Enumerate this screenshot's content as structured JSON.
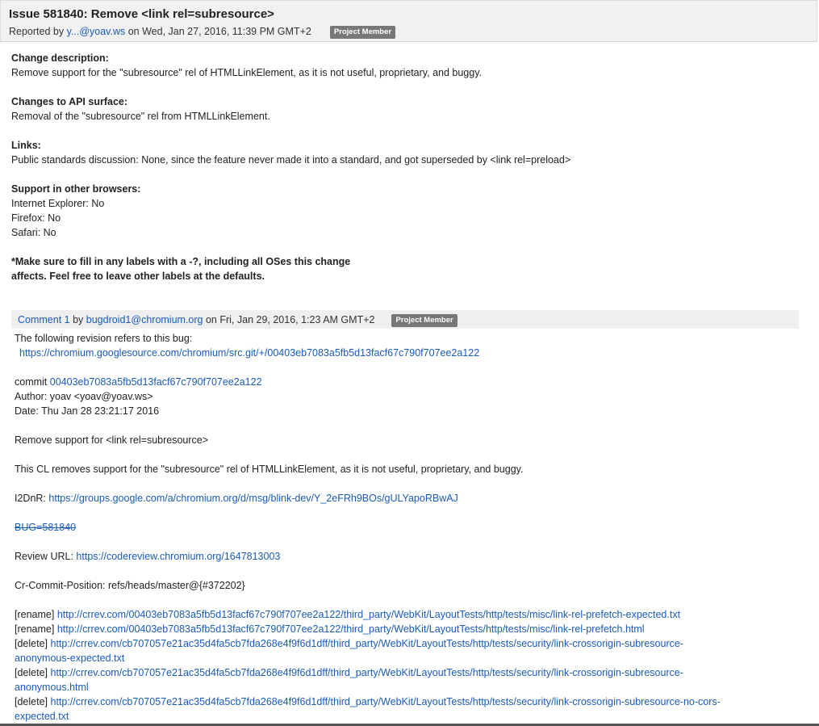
{
  "issue": {
    "title": "Issue 581840: Remove <link rel=subresource>",
    "reported_prefix": "Reported by",
    "reporter": "y...@yoav.ws",
    "reported_on": "on Wed, Jan 27, 2016, 11:39 PM GMT+2",
    "badge": "Project Member"
  },
  "description": {
    "change_desc_heading": "Change description:",
    "change_desc_text": "Remove support for the \"subresource\" rel of HTMLLinkElement, as it is not useful, proprietary, and buggy.",
    "api_heading": "Changes to API surface:",
    "api_text": "Removal of the \"subresource\" rel from HTMLLinkElement.",
    "links_heading": "Links:",
    "links_text": "Public standards discussion: None, since the feature never made it into a standard, and got superseded by <link rel=preload>",
    "browsers_heading": "Support in other browsers:",
    "browsers": [
      "Internet Explorer: No",
      "Firefox: No",
      "Safari: No"
    ],
    "note_line1": "*Make sure to fill in any labels with a -?, including all OSes this change",
    "note_line2": "affects. Feel free to leave other labels at the defaults."
  },
  "comment": {
    "label": "Comment 1",
    "by": "by",
    "author": "bugdroid1@chromium.org",
    "date": "on Fri, Jan 29, 2016, 1:23 AM GMT+2",
    "badge": "Project Member",
    "intro": "The following revision refers to this bug:",
    "revision_url": "https://chromium.googlesource.com/chromium/src.git/+/00403eb7083a5fb5d13facf67c790f707ee2a122",
    "commit_label": "commit",
    "commit_hash": "00403eb7083a5fb5d13facf67c790f707ee2a122",
    "author_line": "Author: yoav <yoav@yoav.ws>",
    "date_line": "Date: Thu Jan 28 23:21:17 2016",
    "summary": "Remove support for <link rel=subresource>",
    "cl_text": "This CL removes support for the \"subresource\" rel of HTMLLinkElement, as it is not useful, proprietary, and buggy.",
    "i2d_label": "I2DnR:",
    "i2d_url": "https://groups.google.com/a/chromium.org/d/msg/blink-dev/Y_2eFRh9BOs/gULYapoRBwAJ",
    "bug_ref": "BUG=581840",
    "review_label": "Review URL:",
    "review_url": "https://codereview.chromium.org/1647813003",
    "cr_commit": "Cr-Commit-Position: refs/heads/master@{#372202}",
    "files": [
      {
        "action": "[rename]",
        "url": "http://crrev.com/00403eb7083a5fb5d13facf67c790f707ee2a122/third_party/WebKit/LayoutTests/http/tests/misc/link-rel-prefetch-expected.txt",
        "url_cont": ""
      },
      {
        "action": "[rename]",
        "url": "http://crrev.com/00403eb7083a5fb5d13facf67c790f707ee2a122/third_party/WebKit/LayoutTests/http/tests/misc/link-rel-prefetch.html",
        "url_cont": ""
      },
      {
        "action": "[delete]",
        "url": "http://crrev.com/cb707057e21ac35d4fa5cb7fda268e4f9f6d1dff/third_party/WebKit/LayoutTests/http/tests/security/link-crossorigin-subresource-",
        "url_cont": "anonymous-expected.txt"
      },
      {
        "action": "[delete]",
        "url": "http://crrev.com/cb707057e21ac35d4fa5cb7fda268e4f9f6d1dff/third_party/WebKit/LayoutTests/http/tests/security/link-crossorigin-subresource-",
        "url_cont": "anonymous.html"
      },
      {
        "action": "[delete]",
        "url": "http://crrev.com/cb707057e21ac35d4fa5cb7fda268e4f9f6d1dff/third_party/WebKit/LayoutTests/http/tests/security/link-crossorigin-subresource-no-cors-",
        "url_cont": "expected.txt"
      }
    ]
  }
}
